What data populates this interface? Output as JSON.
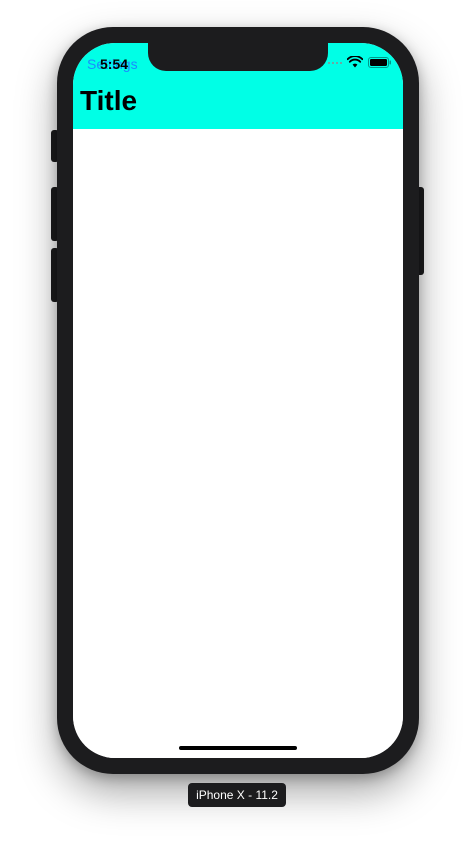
{
  "status_bar": {
    "back_label": "Settings",
    "time": "5:54",
    "wifi_icon": "wifi-icon",
    "battery_icon": "battery-icon"
  },
  "nav_bar": {
    "title": "Title",
    "background_color": "#00ffe6"
  },
  "simulator": {
    "device_label": "iPhone X - 11.2"
  }
}
